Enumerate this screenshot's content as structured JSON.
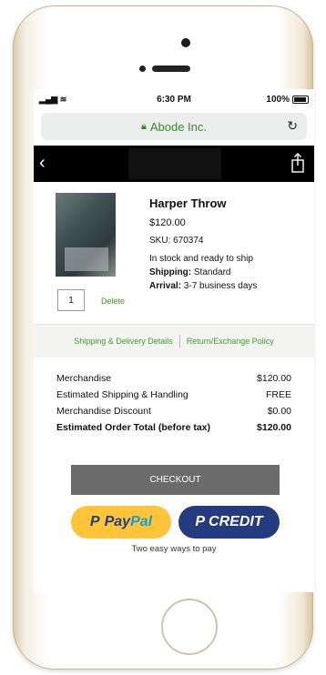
{
  "status": {
    "time": "6:30 PM",
    "battery": "100%"
  },
  "browser": {
    "site_name": "Abode Inc."
  },
  "product": {
    "name": "Harper Throw",
    "price": "$120.00",
    "sku": "SKU: 670374",
    "stock": "In stock and ready to ship",
    "shipping_label": "Shipping:",
    "shipping_value": "Standard",
    "arrival_label": "Arrival:",
    "arrival_value": "3-7 business days",
    "quantity": "1",
    "delete_label": "Delete"
  },
  "links": {
    "shipping_details": "Shipping & Delivery Details",
    "return_policy": "Return/Exchange Policy"
  },
  "totals": {
    "merch_label": "Merchandise",
    "merch_value": "$120.00",
    "ship_label": "Estimated Shipping & Handling",
    "ship_value": "FREE",
    "discount_label": "Merchandise Discount",
    "discount_value": "$0.00",
    "total_label": "Estimated Order Total (before tax)",
    "total_value": "$120.00"
  },
  "checkout": {
    "label": "CHECKOUT"
  },
  "payments": {
    "paypal_pay": "Pay",
    "paypal_pal": "Pal",
    "credit_label": "CREDIT",
    "tagline": "Two easy ways to pay"
  },
  "colors": {
    "accent": "#3f9a2a",
    "paypal_yellow": "#ffc439",
    "paypal_blue": "#253b80"
  },
  "icons": [
    "signal-icon",
    "wifi-icon",
    "battery-icon",
    "lock-icon",
    "reload-icon",
    "back-icon",
    "share-icon"
  ]
}
